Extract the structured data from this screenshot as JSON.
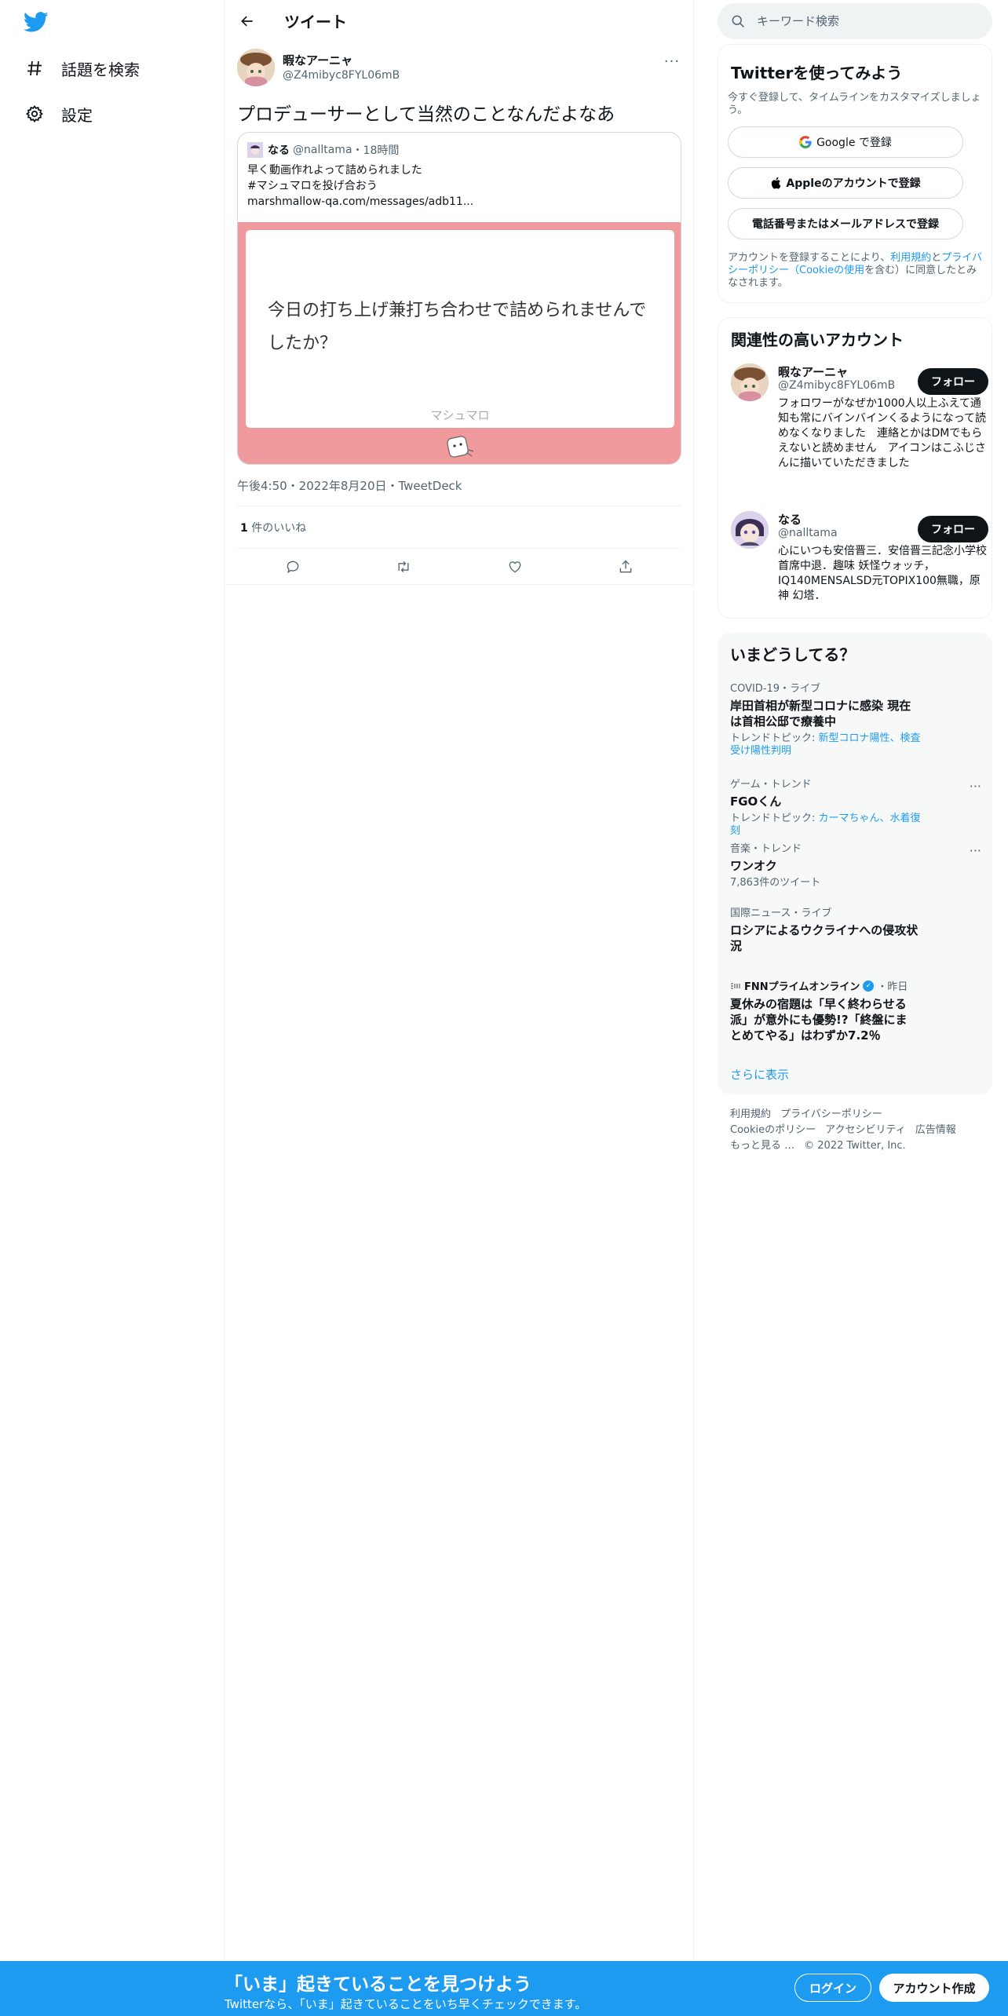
{
  "nav": {
    "items": [
      {
        "label": "話題を検索",
        "icon": "hashtag-icon"
      },
      {
        "label": "設定",
        "icon": "gear-icon"
      }
    ]
  },
  "header": {
    "title": "ツイート"
  },
  "tweet": {
    "author_name": "暇なアーニャ",
    "author_handle": "@Z4mibyc8FYL06mB",
    "text": "プロデューサーとして当然のことなんだよなあ",
    "quote": {
      "name": "なる",
      "handle": "@nalltama",
      "time": "18時間",
      "lines": [
        "早く動画作れよって詰められました",
        "#マシュマロを投げ合おう",
        "marshmallow-qa.com/messages/adb11..."
      ],
      "card_text": "今日の打ち上げ兼打ち合わせで詰められませんでしたか？",
      "card_brand": "マシュマロ",
      "card_bg": "#f09a9d"
    },
    "meta": "午後4:50・2022年8月20日・TweetDeck",
    "likes_count": "1",
    "likes_label": "件のいいね"
  },
  "search": {
    "placeholder": "キーワード検索"
  },
  "signup": {
    "title": "Twitterを使ってみよう",
    "subtitle": "今すぐ登録して、タイムラインをカスタマイズしましょう。",
    "google_label": "Google で登録",
    "apple_label": "Appleのアカウントで登録",
    "phone_label": "電話番号またはメールアドレスで登録",
    "terms_prefix": "アカウントを登録することにより、",
    "terms_link1": "利用規約",
    "terms_mid1": "と",
    "terms_link2": "プライバシーポリシー（Cookieの使用",
    "terms_suffix": "を含む）に同意したとみなされます。"
  },
  "related": {
    "title": "関連性の高いアカウント",
    "accounts": [
      {
        "name": "暇なアーニャ",
        "handle": "@Z4mibyc8FYL06mB",
        "bio": "フォロワーがなぜか1000人以上ふえて通知も常にバインバインくるようになって読めなくなりました　連絡とかはDMでもらえないと読めません　アイコンはこふじさんに描いていただきました",
        "follow": "フォロー"
      },
      {
        "name": "なる",
        "handle": "@nalltama",
        "bio": "心にいつも安倍晋三．安倍晋三記念小学校首席中退．趣味 妖怪ウォッチ，IQ140MENSALSD元TOPIX100無職，原神 幻塔．",
        "follow": "フォロー"
      }
    ]
  },
  "trends": {
    "title": "いまどうしてる？",
    "items": [
      {
        "meta": "COVID-19・ライブ",
        "name": "岸田首相が新型コロナに感染 現在は首相公邸で療養中",
        "sub_prefix": "トレンドトピック: ",
        "sub_link": "新型コロナ陽性、検査受け陽性判明"
      },
      {
        "meta": "ゲーム・トレンド",
        "name": "FGOくん",
        "sub_prefix": "トレンドトピック: ",
        "sub_link": "カーマちゃん、水着復刻"
      },
      {
        "meta": "音楽・トレンド",
        "name": "ワンオク",
        "sub_plain": "7,863件のツイート"
      },
      {
        "meta": "国際ニュース・ライブ",
        "name": "ロシアによるウクライナへの侵攻状況"
      }
    ],
    "news": {
      "source": "FNNプライムオンライン",
      "time": "・昨日",
      "headline": "夏休みの宿題は「早く終わらせる派」が意外にも優勢!?「終盤にまとめてやる」はわずか7.2％"
    },
    "show_more": "さらに表示"
  },
  "footer": {
    "links": [
      "利用規約",
      "プライバシーポリシー",
      "Cookieのポリシー",
      "アクセシビリティ",
      "広告情報",
      "もっと見る …",
      "© 2022 Twitter, Inc."
    ]
  },
  "bottombar": {
    "title": "「いま」起きていることを見つけよう",
    "subtitle": "Twitterなら、「いま」起きていることをいち早くチェックできます。",
    "login": "ログイン",
    "signup": "アカウント作成"
  },
  "colors": {
    "accent": "#1d9bf0",
    "dark": "#0f1419",
    "muted": "#536471"
  }
}
